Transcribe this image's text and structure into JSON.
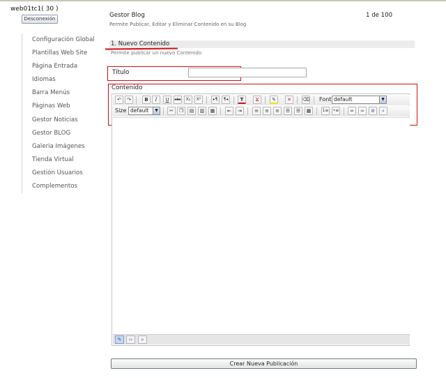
{
  "session": {
    "user": "web01tc1( 30 )",
    "logout_label": "Desconexión"
  },
  "sidebar": {
    "items": [
      "Configuración Global",
      "Plantillas Web Site",
      "Página Entrada",
      "Idiomas",
      "Barra Menús",
      "Páginas Web",
      "Gestor Noticias",
      "Gestor BLOG",
      "Galeria Imágenes",
      "Tienda Virtual",
      "Gestión Usuarios",
      "Complementos"
    ]
  },
  "module": {
    "title": "Gestor Blog",
    "subtitle": "Permite Publicar, Editar y Eliminar Contenido en su Blog",
    "pager": "1  de 100"
  },
  "section": {
    "title": "1. Nuevo Contenido",
    "subtitle": "Permite publicar un nuevo Contenido"
  },
  "form": {
    "title_label": "Título",
    "title_value": "",
    "content_label": "Contenido"
  },
  "editor": {
    "font_label": "Font",
    "font_value": "default",
    "size_label": "Size",
    "size_value": "default",
    "toolbar_row1": [
      "undo-icon",
      "redo-icon",
      "bold-icon",
      "italic-icon",
      "underline-icon",
      "strikethrough-icon",
      "subscript-icon",
      "superscript-icon",
      "ltr-icon",
      "rtl-icon",
      "text-color-icon",
      "remove-text-color-icon",
      "highlight-color-icon",
      "remove-highlight-icon",
      "eraser-icon"
    ],
    "toolbar_row2": [
      "cut-icon",
      "copy-icon",
      "paste-icon",
      "paste-text-icon",
      "paste-word-icon",
      "outdent-icon",
      "indent-icon",
      "align-left-icon",
      "align-center-icon",
      "align-right-icon",
      "justify-icon",
      "table-icon",
      "ordered-list-icon",
      "unordered-list-icon",
      "horizontal-rule-icon",
      "link-icon",
      "unlink-icon",
      "preview-icon"
    ],
    "glyphs": {
      "bold": "B",
      "italic": "I",
      "underline": "U",
      "strike": "abc",
      "sub": "X₂",
      "sup": "X²",
      "text_color": "T",
      "remove_color": "Ϫ"
    }
  },
  "submit_label": "Crear Nueva Publicación",
  "colors": {
    "highlight_red": "#d01010",
    "link_blue": "#2a4a8a"
  }
}
